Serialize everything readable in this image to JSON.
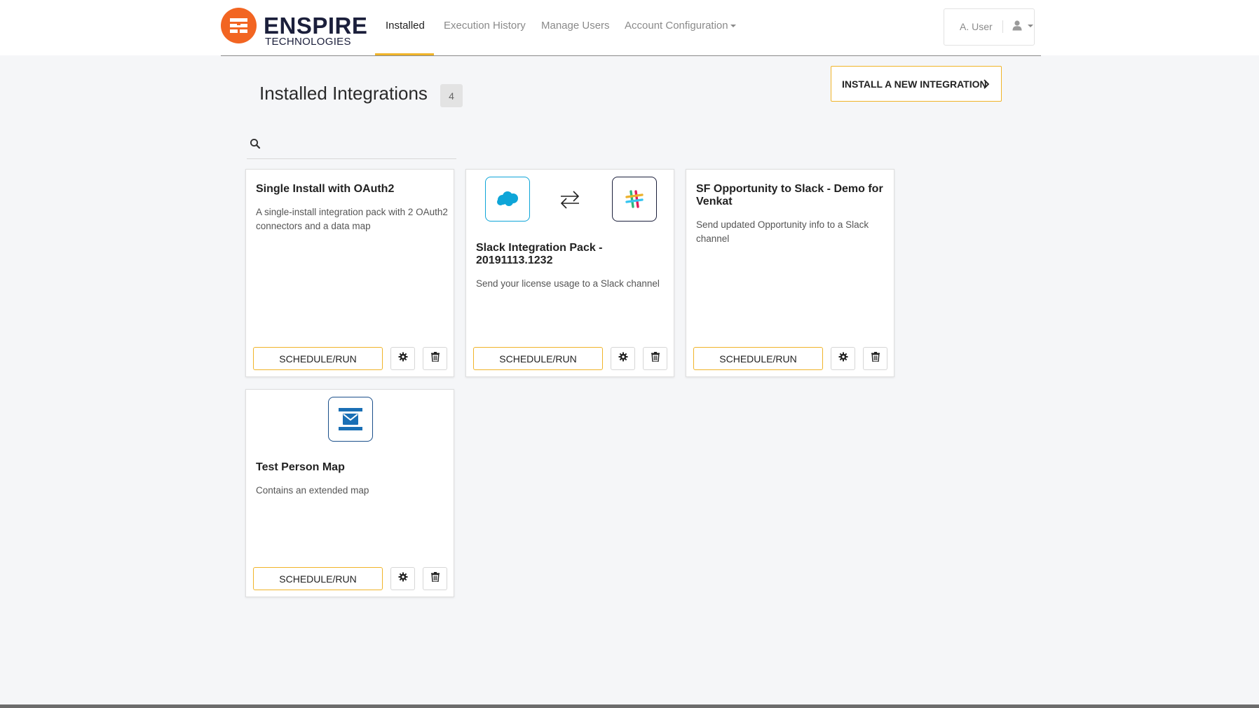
{
  "brand": {
    "name_line1": "ENSPIRE",
    "name_line2": "TECHNOLOGIES",
    "accent": "#f26522",
    "nav_accent": "#f0b429"
  },
  "nav": {
    "items": [
      {
        "label": "Installed",
        "active": true
      },
      {
        "label": "Execution History",
        "active": false
      },
      {
        "label": "Manage Users",
        "active": false
      },
      {
        "label": "Account Configuration",
        "active": false,
        "dropdown": true
      }
    ]
  },
  "user": {
    "name": "A. User",
    "icon": "user-icon"
  },
  "page": {
    "title": "Installed Integrations",
    "count": "4"
  },
  "install_button": {
    "label": "INSTALL A NEW INTEGRATION",
    "icon": "chevron-right-icon"
  },
  "search": {
    "placeholder": "",
    "value": "",
    "icon": "search-icon"
  },
  "cards": [
    {
      "title": "Single Install with OAuth2",
      "description": "A single-install integration pack with 2 OAuth2 connectors and a data map",
      "run_label": "SCHEDULE/RUN",
      "logos": []
    },
    {
      "title": "Slack Integration Pack - 20191113.1232",
      "description": "Send your license usage to a Slack channel",
      "run_label": "SCHEDULE/RUN",
      "logos": [
        "salesforce-logo",
        "sync-arrows-icon",
        "slack-logo"
      ]
    },
    {
      "title": "SF Opportunity to Slack - Demo for Venkat",
      "description": "Send updated Opportunity info to a Slack channel",
      "run_label": "SCHEDULE/RUN",
      "logos": []
    },
    {
      "title": "Test Person Map",
      "description": "Contains an extended map",
      "run_label": "SCHEDULE/RUN",
      "logos": [
        "mail-logo"
      ]
    }
  ]
}
